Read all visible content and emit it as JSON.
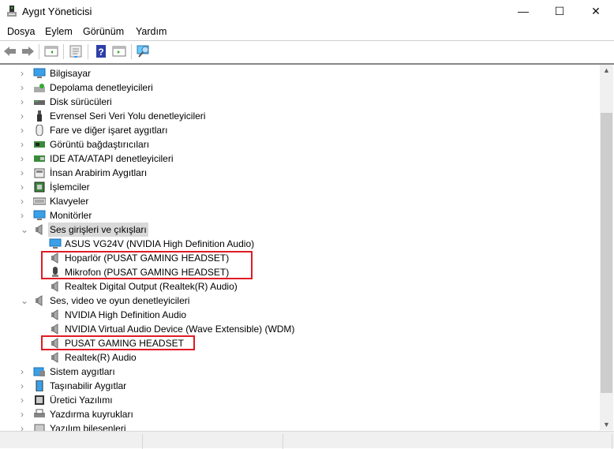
{
  "window": {
    "title": "Aygıt Yöneticisi",
    "minimize": "—",
    "maximize": "☐",
    "close": "✕"
  },
  "menu": [
    "Dosya",
    "Eylem",
    "Görünüm",
    "Yardım"
  ],
  "toolbar": [
    "back-icon",
    "forward-icon",
    "show-hide-tree-icon",
    "properties-icon",
    "help-icon",
    "action-pane-icon",
    "scan-hardware-icon"
  ],
  "tree": [
    {
      "level": 0,
      "state": "collapsed",
      "icon": "computer-icon",
      "label": "Bilgisayar"
    },
    {
      "level": 0,
      "state": "collapsed",
      "icon": "storage-icon",
      "label": "Depolama denetleyicileri"
    },
    {
      "level": 0,
      "state": "collapsed",
      "icon": "disk-icon",
      "label": "Disk sürücüleri"
    },
    {
      "level": 0,
      "state": "collapsed",
      "icon": "usb-icon",
      "label": "Evrensel Seri Veri Yolu denetleyicileri"
    },
    {
      "level": 0,
      "state": "collapsed",
      "icon": "mouse-icon",
      "label": "Fare ve diğer işaret aygıtları"
    },
    {
      "level": 0,
      "state": "collapsed",
      "icon": "display-adapter-icon",
      "label": "Görüntü bağdaştırıcıları"
    },
    {
      "level": 0,
      "state": "collapsed",
      "icon": "ide-icon",
      "label": "IDE ATA/ATAPI denetleyicileri"
    },
    {
      "level": 0,
      "state": "collapsed",
      "icon": "hid-icon",
      "label": "İnsan Arabirim Aygıtları"
    },
    {
      "level": 0,
      "state": "collapsed",
      "icon": "processor-icon",
      "label": "İşlemciler"
    },
    {
      "level": 0,
      "state": "collapsed",
      "icon": "keyboard-icon",
      "label": "Klavyeler"
    },
    {
      "level": 0,
      "state": "collapsed",
      "icon": "monitor-icon",
      "label": "Monitörler"
    },
    {
      "level": 0,
      "state": "expanded",
      "icon": "speaker-icon",
      "label": "Ses girişleri ve çıkışları",
      "selected": true
    },
    {
      "level": 1,
      "icon": "monitor-icon",
      "label": "ASUS VG24V (NVIDIA High Definition Audio)"
    },
    {
      "level": 1,
      "icon": "speaker-icon",
      "label": "Hoparlör (PUSAT GAMING HEADSET)"
    },
    {
      "level": 1,
      "icon": "microphone-icon",
      "label": "Mikrofon (PUSAT GAMING HEADSET)"
    },
    {
      "level": 1,
      "icon": "speaker-icon",
      "label": "Realtek Digital Output (Realtek(R) Audio)"
    },
    {
      "level": 0,
      "state": "expanded",
      "icon": "speaker-icon",
      "label": "Ses, video ve oyun denetleyicileri"
    },
    {
      "level": 1,
      "icon": "speaker-icon",
      "label": "NVIDIA High Definition Audio"
    },
    {
      "level": 1,
      "icon": "speaker-icon",
      "label": "NVIDIA Virtual Audio Device (Wave Extensible) (WDM)"
    },
    {
      "level": 1,
      "icon": "speaker-icon",
      "label": "PUSAT GAMING HEADSET"
    },
    {
      "level": 1,
      "icon": "speaker-icon",
      "label": "Realtek(R) Audio"
    },
    {
      "level": 0,
      "state": "collapsed",
      "icon": "system-icon",
      "label": "Sistem aygıtları"
    },
    {
      "level": 0,
      "state": "collapsed",
      "icon": "portable-icon",
      "label": "Taşınabilir Aygıtlar"
    },
    {
      "level": 0,
      "state": "collapsed",
      "icon": "firmware-icon",
      "label": "Üretici Yazılımı"
    },
    {
      "level": 0,
      "state": "collapsed",
      "icon": "printer-queue-icon",
      "label": "Yazdırma kuyrukları"
    },
    {
      "level": 0,
      "state": "collapsed",
      "icon": "software-component-icon",
      "label": "Yazılım bileşenleri"
    }
  ],
  "highlight_color": "#e01b24",
  "scrollbar": {
    "position_fraction": 0.15,
    "visible_fraction": 0.77
  }
}
